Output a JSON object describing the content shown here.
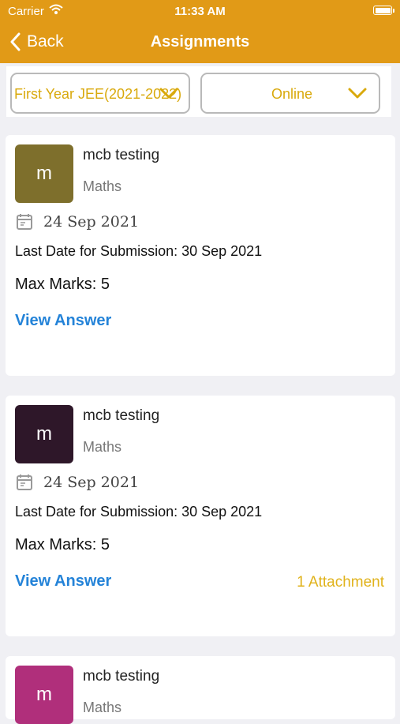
{
  "status_bar": {
    "carrier": "Carrier",
    "time": "11:33 AM"
  },
  "nav": {
    "back_label": "Back",
    "title": "Assignments"
  },
  "filters": {
    "course": "First Year JEE(2021-2022)",
    "mode": "Online"
  },
  "colors": {
    "header": "#e19a17",
    "dropdown_text": "#d9a90c",
    "link": "#2483d8",
    "attachment": "#e0b21a"
  },
  "assignments": [
    {
      "avatar_letter": "m",
      "avatar_color": "#7e6f2c",
      "title": "mcb testing",
      "subject": "Maths",
      "date": "24 Sep 2021",
      "deadline": "Last Date for Submission: 30 Sep 2021",
      "marks": "Max Marks: 5",
      "action": "View Answer",
      "attachments": ""
    },
    {
      "avatar_letter": "m",
      "avatar_color": "#2e1729",
      "title": "mcb testing",
      "subject": "Maths",
      "date": "24 Sep 2021",
      "deadline": "Last Date for Submission: 30 Sep 2021",
      "marks": "Max Marks: 5",
      "action": "View Answer",
      "attachments": "1 Attachment"
    },
    {
      "avatar_letter": "m",
      "avatar_color": "#b02f7b",
      "title": "mcb testing",
      "subject": "Maths"
    }
  ]
}
